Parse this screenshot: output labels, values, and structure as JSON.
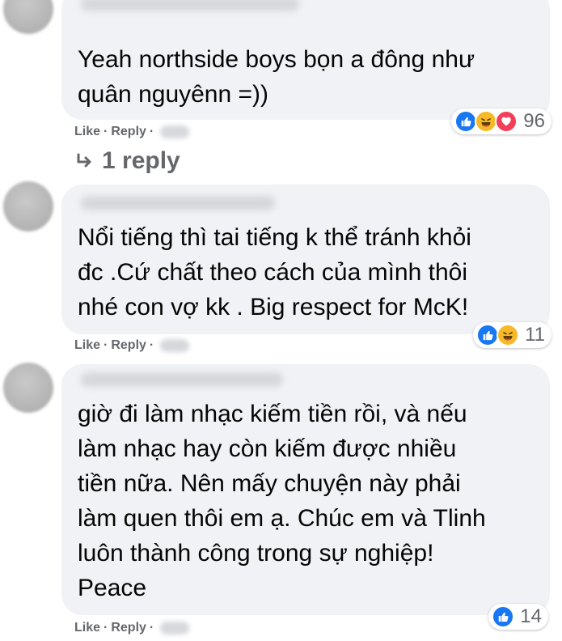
{
  "colors": {
    "bubble": "#f0f2f5",
    "meta_gray": "#65676b",
    "like_blue": "#1877f2",
    "haha_yellow": "#f7b928",
    "love_red": "#f33e58"
  },
  "comments": [
    {
      "text": "Yeah northside boys bọn a đông như\nquân nguyênn =))",
      "reactions": {
        "icons": [
          "like-icon",
          "haha-icon",
          "love-icon"
        ],
        "count": "96"
      },
      "actions": {
        "like": "Like",
        "reply": "Reply",
        "sep": "·"
      },
      "replies_label": "1 reply"
    },
    {
      "text": "Nổi tiếng thì tai tiếng k thể tránh khỏi\nđc .Cứ chất theo cách của mình thôi\nnhé con vợ kk . Big respect for McK!",
      "reactions": {
        "icons": [
          "like-icon",
          "haha-icon"
        ],
        "count": "11"
      },
      "actions": {
        "like": "Like",
        "reply": "Reply",
        "sep": "·"
      }
    },
    {
      "text": "giờ đi làm nhạc kiếm tiền rồi, và nếu\nlàm nhạc hay còn kiếm được nhiều\ntiền nữa. Nên mấy chuyện này phải\nlàm quen thôi em ạ. Chúc em và Tlinh\nluôn thành công trong sự nghiệp!\nPeace",
      "reactions": {
        "icons": [
          "like-icon"
        ],
        "count": "14"
      },
      "actions": {
        "like": "Like",
        "reply": "Reply",
        "sep": "·"
      }
    }
  ]
}
